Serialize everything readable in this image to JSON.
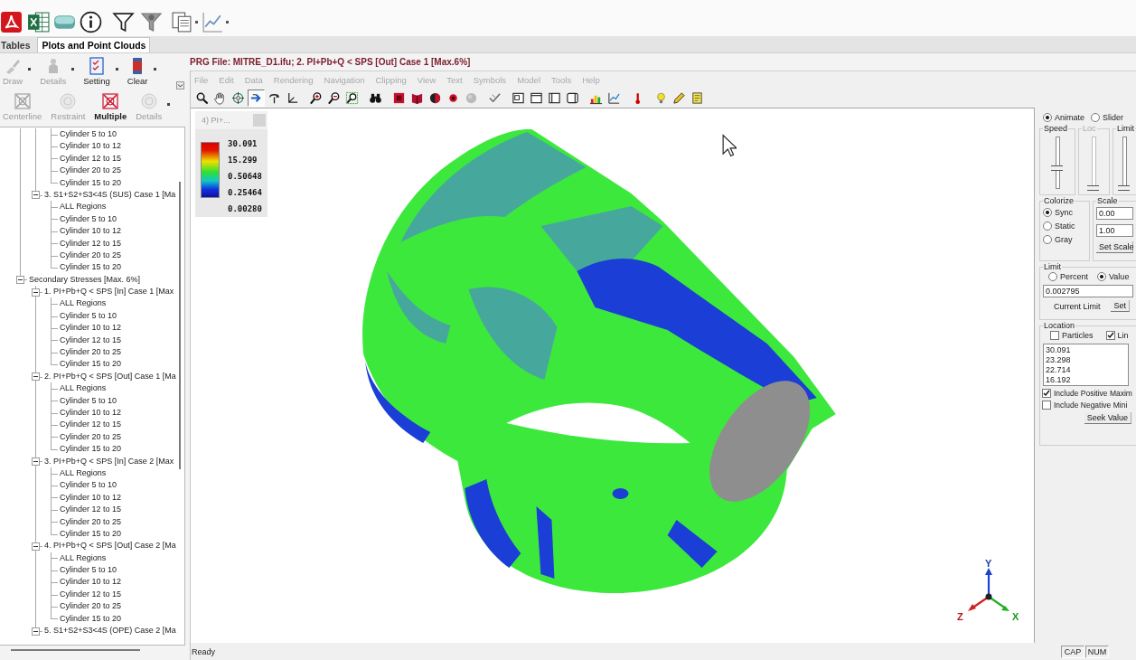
{
  "ribbon_tabs": [
    {
      "label": "Tables",
      "selected": false
    },
    {
      "label": "Plots and Point Clouds",
      "selected": true
    }
  ],
  "ribbon": [
    [
      {
        "label": "Draw",
        "disabled": true,
        "selected": false,
        "dropdown": true
      },
      {
        "label": "Details",
        "disabled": true,
        "selected": false,
        "dropdown": true
      },
      {
        "label": "Setting",
        "disabled": false,
        "selected": false,
        "dropdown": true
      },
      {
        "label": "Clear",
        "disabled": false,
        "selected": false,
        "dropdown": true
      }
    ],
    [
      {
        "label": "Centerline",
        "disabled": true,
        "selected": false,
        "dropdown": false
      },
      {
        "label": "Restraint",
        "disabled": true,
        "selected": false,
        "dropdown": false
      },
      {
        "label": "Multiple",
        "disabled": false,
        "selected": true,
        "dropdown": false
      },
      {
        "label": "Details",
        "disabled": true,
        "selected": false,
        "dropdown": true
      }
    ]
  ],
  "tree": [
    {
      "children": [
        {
          "children": [
            {
              "label": "Cylinder 5 to 10"
            },
            {
              "label": "Cylinder 10 to 12"
            },
            {
              "label": "Cylinder 12 to 15"
            },
            {
              "label": "Cylinder 20 to 25"
            },
            {
              "label": "Cylinder 15 to 20"
            }
          ]
        },
        {
          "label": "3. S1+S2+S3<4S (SUS) Case 1 [Ma",
          "expanded": true,
          "children": [
            {
              "label": "ALL Regions"
            },
            {
              "label": "Cylinder 5 to 10"
            },
            {
              "label": "Cylinder 10 to 12"
            },
            {
              "label": "Cylinder 12 to 15"
            },
            {
              "label": "Cylinder 20 to 25"
            },
            {
              "label": "Cylinder 15 to 20"
            }
          ]
        }
      ]
    },
    {
      "label": "Secondary Stresses [Max. 6%]",
      "expanded": true,
      "children": [
        {
          "label": "1. PI+Pb+Q < SPS [In] Case 1 [Max",
          "expanded": true,
          "children": [
            {
              "label": "ALL Regions"
            },
            {
              "label": "Cylinder 5 to 10"
            },
            {
              "label": "Cylinder 10 to 12"
            },
            {
              "label": "Cylinder 12 to 15"
            },
            {
              "label": "Cylinder 20 to 25"
            },
            {
              "label": "Cylinder 15 to 20"
            }
          ]
        },
        {
          "label": "2. PI+Pb+Q < SPS [Out] Case 1 [Ma",
          "expanded": true,
          "children": [
            {
              "label": "ALL Regions"
            },
            {
              "label": "Cylinder 5 to 10"
            },
            {
              "label": "Cylinder 10 to 12"
            },
            {
              "label": "Cylinder 12 to 15"
            },
            {
              "label": "Cylinder 20 to 25"
            },
            {
              "label": "Cylinder 15 to 20"
            }
          ]
        },
        {
          "label": "3. PI+Pb+Q < SPS [In] Case 2 [Max",
          "expanded": true,
          "children": [
            {
              "label": "ALL Regions"
            },
            {
              "label": "Cylinder 5 to 10"
            },
            {
              "label": "Cylinder 10 to 12"
            },
            {
              "label": "Cylinder 12 to 15"
            },
            {
              "label": "Cylinder 20 to 25"
            },
            {
              "label": "Cylinder 15 to 20"
            }
          ]
        },
        {
          "label": "4. PI+Pb+Q < SPS [Out] Case 2 [Ma",
          "expanded": true,
          "children": [
            {
              "label": "ALL Regions"
            },
            {
              "label": "Cylinder 5 to 10"
            },
            {
              "label": "Cylinder 10 to 12"
            },
            {
              "label": "Cylinder 12 to 15"
            },
            {
              "label": "Cylinder 20 to 25"
            },
            {
              "label": "Cylinder 15 to 20"
            }
          ]
        },
        {
          "label": "5. S1+S2+S3<4S (OPE) Case 2 [Ma",
          "expanded": true
        }
      ]
    }
  ],
  "viewer": {
    "title": "PRG File: MITRE_D1.ifu; 2. PI+Pb+Q < SPS [Out] Case 1 [Max.6%]",
    "menu": [
      {
        "label": "File",
        "disabled": true
      },
      {
        "label": "Edit",
        "disabled": true
      },
      {
        "label": "Data",
        "disabled": true
      },
      {
        "label": "Rendering",
        "disabled": true
      },
      {
        "label": "Navigation",
        "disabled": true
      },
      {
        "label": "Clipping",
        "disabled": true
      },
      {
        "label": "View",
        "disabled": true
      },
      {
        "label": "Text",
        "disabled": true
      },
      {
        "label": "Symbols",
        "disabled": true
      },
      {
        "label": "Model",
        "disabled": true
      },
      {
        "label": "Tools",
        "disabled": true
      },
      {
        "label": "Help",
        "disabled": true
      }
    ],
    "toolbar_groups": [
      [
        {
          "selected": false,
          "disabled": false
        },
        {
          "selected": false,
          "disabled": false
        },
        {
          "selected": false,
          "disabled": false
        },
        {
          "selected": true,
          "disabled": false
        },
        {
          "selected": false,
          "disabled": false
        },
        {
          "selected": false,
          "disabled": false
        }
      ],
      [
        {
          "selected": false,
          "disabled": false
        },
        {
          "selected": false,
          "disabled": false
        },
        {
          "selected": false,
          "disabled": false
        }
      ],
      [
        {
          "selected": false,
          "disabled": false
        }
      ],
      [
        {
          "selected": false,
          "disabled": false
        },
        {
          "selected": false,
          "disabled": false
        },
        {
          "selected": false,
          "disabled": false
        },
        {
          "selected": false,
          "disabled": false
        },
        {
          "selected": false,
          "disabled": true
        }
      ],
      [
        {
          "selected": false,
          "disabled": false
        }
      ],
      [
        {
          "selected": false,
          "disabled": false
        },
        {
          "selected": false,
          "disabled": false
        },
        {
          "selected": false,
          "disabled": false
        },
        {
          "selected": false,
          "disabled": false
        }
      ],
      [
        {
          "selected": false,
          "disabled": false
        },
        {
          "selected": false,
          "disabled": false
        }
      ],
      [
        {
          "selected": false,
          "disabled": false
        }
      ],
      [
        {
          "selected": false,
          "disabled": false
        },
        {
          "selected": false,
          "disabled": false
        },
        {
          "selected": false,
          "disabled": false
        }
      ]
    ],
    "legend": {
      "title": "4) PI+...",
      "values": [
        "30.091",
        "15.299",
        "0.50648",
        "0.25464",
        "0.00280"
      ]
    },
    "axes": {
      "y": "Y",
      "z": "Z",
      "x": "X"
    }
  },
  "controls": {
    "mode": [
      {
        "label": "Animate",
        "selected": true
      },
      {
        "label": "Slider",
        "selected": false
      }
    ],
    "sliders": [
      {
        "label": "Speed",
        "disabled": false,
        "level": 0.4
      },
      {
        "label": "Loc",
        "disabled": true,
        "level": 0
      },
      {
        "label": "Limit",
        "disabled": false,
        "level": 0
      }
    ],
    "colorize": {
      "title": "Colorize",
      "options": [
        {
          "label": "Sync",
          "selected": true
        },
        {
          "label": "Static",
          "selected": false
        },
        {
          "label": "Gray",
          "selected": false
        }
      ]
    },
    "scale": {
      "title": "Scale",
      "min": "0.00",
      "max": "1.00",
      "button": "Set Scale"
    },
    "limit": {
      "title": "Limit",
      "options": [
        {
          "label": "Percent",
          "selected": false
        },
        {
          "label": "Value",
          "selected": true
        }
      ],
      "value": "0.002795",
      "current_label": "Current Limit",
      "button": "Set"
    },
    "location": {
      "title": "Location",
      "filters": [
        {
          "label": "Particles",
          "checked": false
        },
        {
          "label": "Lin",
          "checked": true
        }
      ],
      "values": [
        "30.091",
        "23.298",
        "22.714",
        "16.192"
      ],
      "options": [
        {
          "label": "Include Positive Maxim",
          "checked": true
        },
        {
          "label": "Include Negative Mini",
          "checked": false
        }
      ],
      "button": "Seek Value"
    }
  },
  "status_bar": {
    "message": "Ready",
    "indicators": [
      "CAP",
      "NUM"
    ]
  }
}
